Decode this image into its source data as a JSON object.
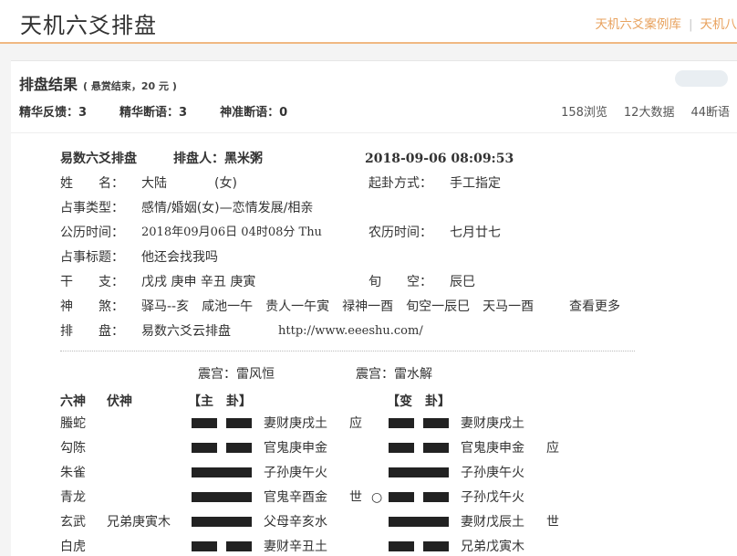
{
  "site": {
    "title": "天机六爻排盘",
    "nav": [
      "天机六爻案例库",
      "天机八"
    ]
  },
  "result": {
    "title": "排盘结果",
    "sub": "( 悬赏结束，20 元 )",
    "stats": [
      "精华反馈：3",
      "精华断语：3",
      "神准断语：0"
    ],
    "metrics": [
      "158浏览",
      "12大数据",
      "44断语"
    ]
  },
  "info": {
    "head_left": "易数六爻排盘",
    "head_mid": "排盘人：黑米粥",
    "head_date": "2018-09-06 08:09:53",
    "name_label": "姓　　名：",
    "name_value": "大陆",
    "gender": "(女)",
    "method_label": "起卦方式：",
    "method_value": "手工指定",
    "topic_label": "占事类型：",
    "topic_value": "感情/婚姻(女)—恋情发展/相亲",
    "solar_label": "公历时间：",
    "solar_value": "2018年09月06日 04时08分 Thu",
    "lunar_label": "农历时间：",
    "lunar_value": "七月廿七",
    "question_label": "占事标题：",
    "question_value": "他还会找我吗",
    "ganzhi_label": "干　　支：",
    "ganzhi_value": "戊戌 庚申 辛丑 庚寅",
    "xunkong_label": "旬　　空：",
    "xunkong_value": "辰巳",
    "shensha_label": "神　　煞：",
    "shensha_value": "驿马--亥　咸池一午　贵人一午寅　禄神一酉　旬空一辰巳　天马一酉",
    "shensha_more": "查看更多",
    "paipan_label": "排　　盘：",
    "paipan_value": "易数六爻云排盘",
    "paipan_url": "http://www.eeeshu.com/"
  },
  "gua": {
    "main_palace": "震宫：雷风恒",
    "change_palace": "震宫：雷水解",
    "col_liushen": "六神",
    "col_fushen": "伏神",
    "col_main": "【主　卦】",
    "col_change": "【变　卦】",
    "rows": [
      {
        "liushen": "螣蛇",
        "fushen": "",
        "main_type": "yin",
        "main_text": "妻财庚戌土",
        "shi": "应",
        "moving": "",
        "change_type": "yin",
        "change_text": "妻财庚戌土",
        "change_shi": ""
      },
      {
        "liushen": "勾陈",
        "fushen": "",
        "main_type": "yin",
        "main_text": "官鬼庚申金",
        "shi": "",
        "moving": "",
        "change_type": "yin",
        "change_text": "官鬼庚申金",
        "change_shi": "应"
      },
      {
        "liushen": "朱雀",
        "fushen": "",
        "main_type": "yang",
        "main_text": "子孙庚午火",
        "shi": "",
        "moving": "",
        "change_type": "yang",
        "change_text": "子孙庚午火",
        "change_shi": ""
      },
      {
        "liushen": "青龙",
        "fushen": "",
        "main_type": "yang",
        "main_text": "官鬼辛酉金",
        "shi": "世",
        "moving": "○",
        "change_type": "yin",
        "change_text": "子孙戊午火",
        "change_shi": ""
      },
      {
        "liushen": "玄武",
        "fushen": "兄弟庚寅木",
        "main_type": "yang",
        "main_text": "父母辛亥水",
        "shi": "",
        "moving": "",
        "change_type": "yang",
        "change_text": "妻财戊辰土",
        "change_shi": "世"
      },
      {
        "liushen": "白虎",
        "fushen": "",
        "main_type": "yin",
        "main_text": "妻财辛丑土",
        "shi": "",
        "moving": "",
        "change_type": "yin",
        "change_text": "兄弟戊寅木",
        "change_shi": ""
      }
    ]
  }
}
